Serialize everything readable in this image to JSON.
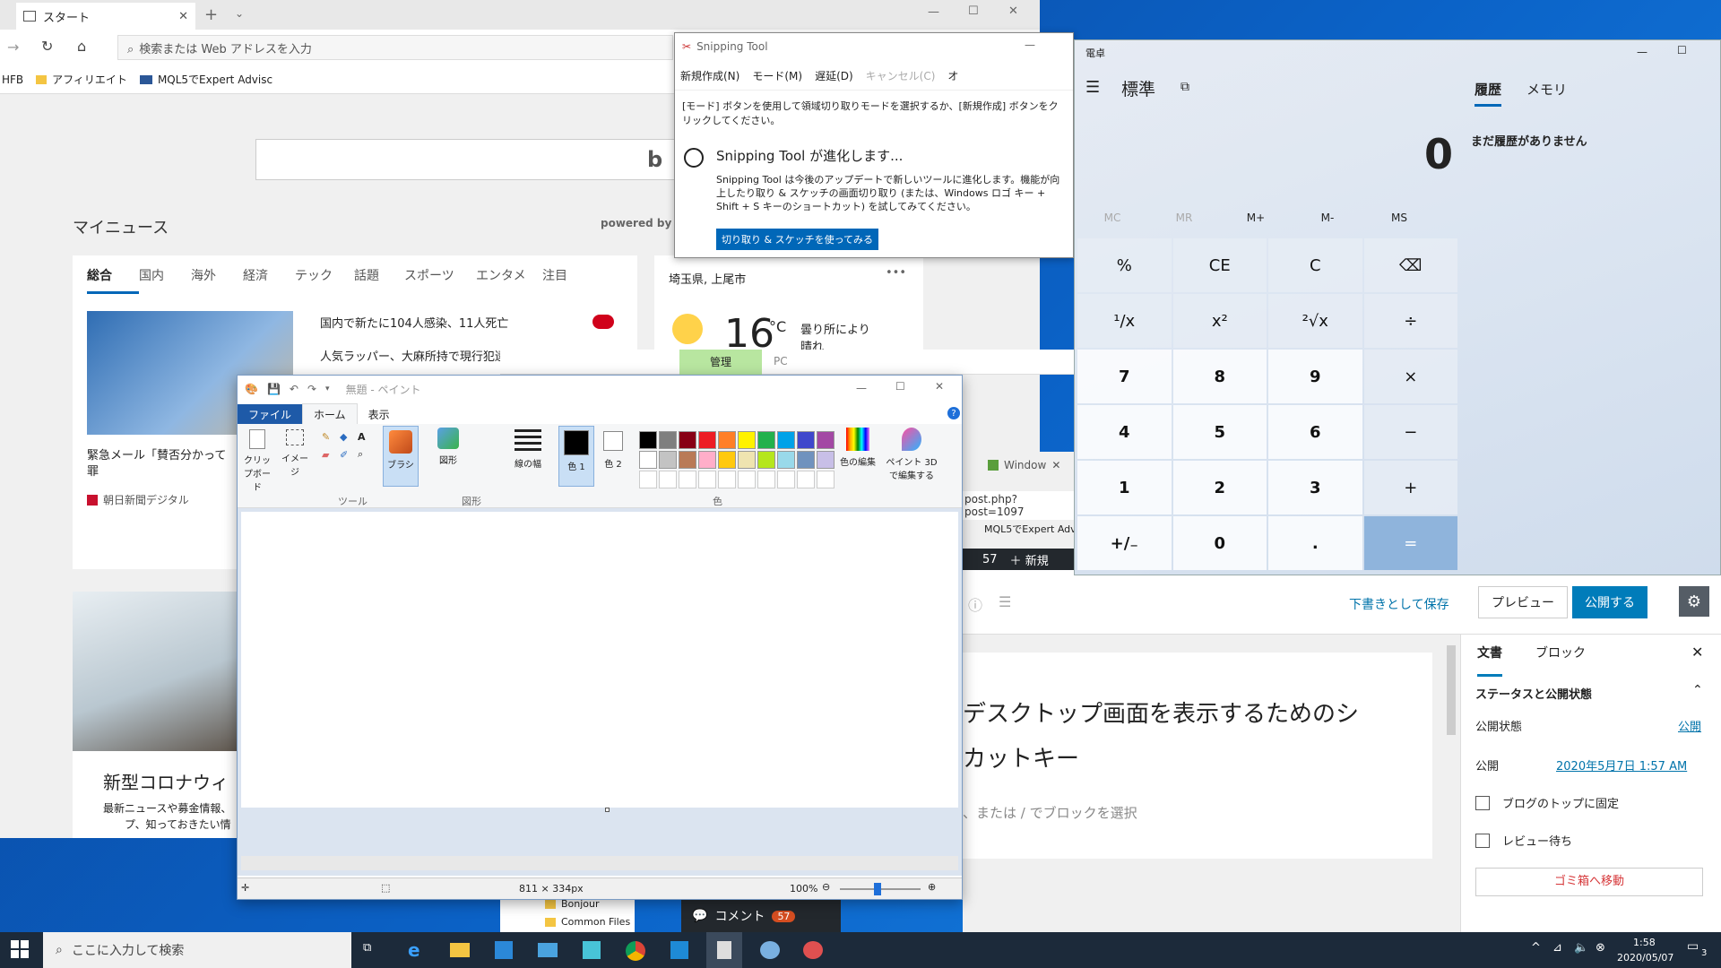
{
  "edge": {
    "tab_title": "スタート",
    "address_placeholder": "検索または Web アドレスを入力",
    "bookmarks": [
      "HFB",
      "アフィリエイト",
      "MQL5でExpert Advisc"
    ],
    "news_header": "マイニュース",
    "powered_by": "powered by M",
    "news_tabs": [
      "総合",
      "国内",
      "海外",
      "経済",
      "テック",
      "話題",
      "スポーツ",
      "エンタメ",
      "注目"
    ],
    "headlines": [
      "国内で新たに104人感染、11人死亡",
      "人気ラッパー、大麻所持で現行犯逮捕"
    ],
    "feature_caption": "緊急メール「賛否分かって",
    "feature_caption2": "罪",
    "feature_source": "朝日新聞デジタル",
    "story2_title": "新型コロナウィ",
    "story2_desc1": "最新ニュースや募金情報、",
    "story2_desc2": "プ、知っておきたい情",
    "weather_location": "埼玉県, 上尾市",
    "weather_temp": "16",
    "weather_unit": "°C",
    "weather_desc1": "曇り所により",
    "weather_desc2": "晴れ"
  },
  "snip": {
    "title": "Snipping Tool",
    "toolbar": [
      "新規作成(N)",
      "モード(M)",
      "遅延(D)",
      "キャンセル(C)",
      "オ"
    ],
    "instructions": "[モード] ボタンを使用して領域切り取りモードを選択するか、[新規作成] ボタンをクリックしてください。",
    "notice_title": "Snipping  Tool が進化します...",
    "notice_body": "Snipping Tool は今後のアップデートで新しいツールに進化します。機能が向上したり取り & スケッチの画面切り取り (または、Windows ロゴ キー + Shift + S キーのショートカット) を試してみてください。",
    "notice_button": "切り取り & スケッチを使ってみる"
  },
  "calc": {
    "app_title": "電卓",
    "mode": "標準",
    "display": "0",
    "tab_history": "履歴",
    "tab_memory": "メモリ",
    "history_empty": "まだ履歴がありません",
    "memory_keys": [
      "MC",
      "MR",
      "M+",
      "M-",
      "MS"
    ],
    "keys": [
      [
        "%",
        "CE",
        "C",
        "⌫"
      ],
      [
        "¹/x",
        "x²",
        "²√x",
        "÷"
      ],
      [
        "7",
        "8",
        "9",
        "×"
      ],
      [
        "4",
        "5",
        "6",
        "−"
      ],
      [
        "1",
        "2",
        "3",
        "+"
      ],
      [
        "+/₋",
        "0",
        ".",
        "="
      ]
    ]
  },
  "explorer_tabs": {
    "manage": "管理",
    "pc": "PC",
    "folders": [
      "Bonjour",
      "Common Files"
    ]
  },
  "paint": {
    "title": "無題 - ペイント",
    "menu_file": "ファイル",
    "tab_home": "ホーム",
    "tab_view": "表示",
    "groups": {
      "clipboard": "クリップボード",
      "image": "イメージ",
      "tools": "ツール",
      "brush": "ブラシ",
      "shapes_btn": "図形",
      "shapes_group": "図形",
      "linewidth": "線の幅",
      "color1": "色 1",
      "color2": "色 2",
      "colors_group": "色",
      "edit_colors": "色の編集",
      "paint3d": "ペイント 3D で編集する"
    },
    "palette": [
      "#000000",
      "#7f7f7f",
      "#880015",
      "#ed1c24",
      "#ff7f27",
      "#fff200",
      "#22b14c",
      "#00a2e8",
      "#3f48cc",
      "#a349a4",
      "#ffffff",
      "#c3c3c3",
      "#b97a57",
      "#ffaec9",
      "#ffc90e",
      "#efe4b0",
      "#b5e61d",
      "#99d9ea",
      "#7092be",
      "#c8bfe7"
    ],
    "canvas_size": "811 × 334px",
    "zoom": "100%"
  },
  "chrome_fragments": {
    "tab": "Window",
    "url": "post.php?post=1097",
    "bookmark": "MQL5でExpert Advis",
    "comments": "57",
    "new": "新規"
  },
  "wp": {
    "save_draft": "下書きとして保存",
    "preview": "プレビュー",
    "publish": "公開する",
    "title_line1": "デスクトップ画面を表示するためのシ",
    "title_line2": "カットキー",
    "block_hint": "、または / でブロックを選択",
    "tab_document": "文書",
    "tab_block": "ブロック",
    "panel_title": "ステータスと公開状態",
    "visibility_label": "公開状態",
    "visibility_value": "公開",
    "publish_label": "公開",
    "publish_date": "2020年5月7日 1:57 AM",
    "sticky": "ブログのトップに固定",
    "pending": "レビュー待ち",
    "trash": "ゴミ箱へ移動",
    "comment_label": "コメント",
    "comment_count": "57"
  },
  "taskbar": {
    "search_placeholder": "ここに入力して検索",
    "time": "1:58",
    "date": "2020/05/07",
    "notification_count": "3"
  }
}
